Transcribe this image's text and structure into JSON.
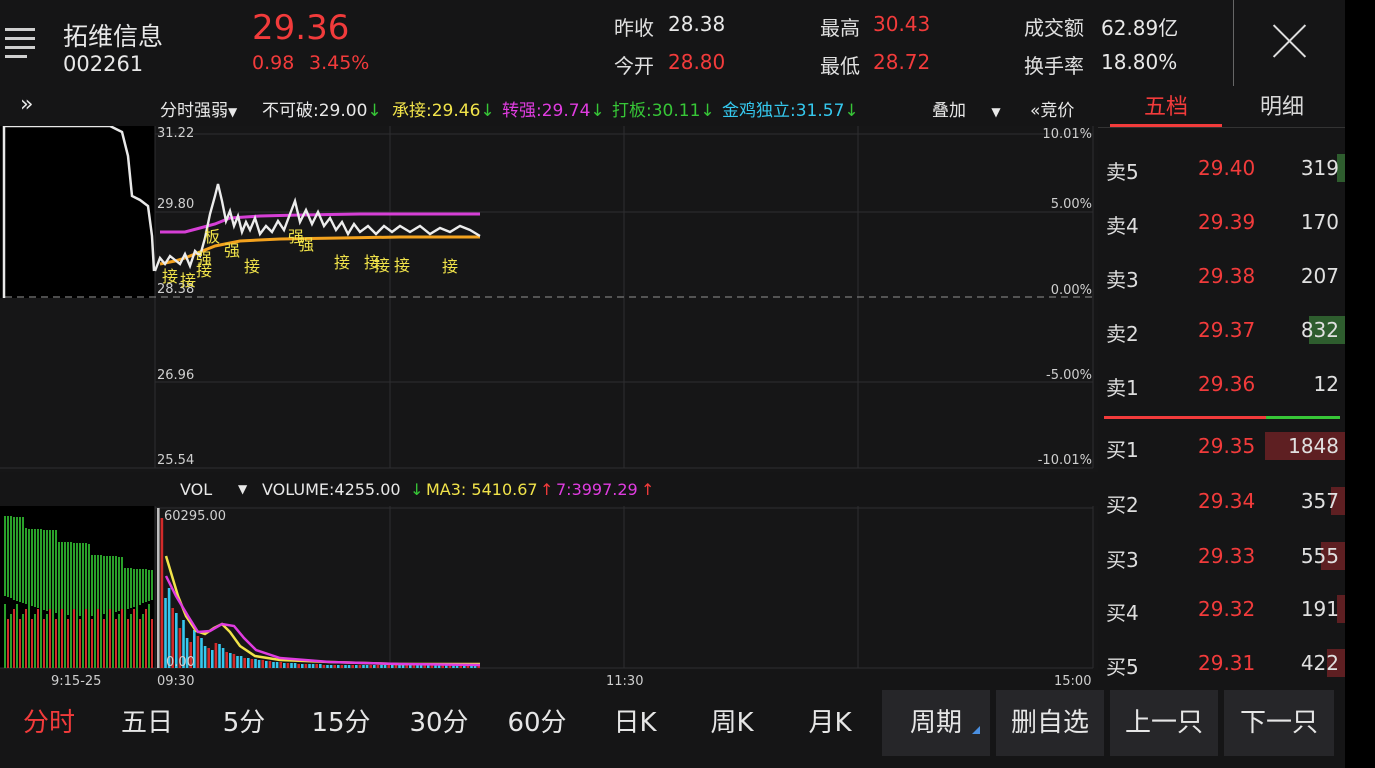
{
  "header": {
    "stock_name": "拓维信息",
    "stock_code": "002261",
    "price": "29.36",
    "change": "0.98",
    "change_pct": "3.45%",
    "prev_close_label": "昨收",
    "prev_close": "28.38",
    "open_label": "今开",
    "open": "28.80",
    "high_label": "最高",
    "high": "30.43",
    "low_label": "最低",
    "low": "28.72",
    "turnover_amt_label": "成交额",
    "turnover_amt": "62.89亿",
    "turnover_rate_label": "换手率",
    "turnover_rate": "18.80%"
  },
  "indicator_bar": {
    "expand_glyph": "»",
    "mode": "分时强弱",
    "items": [
      {
        "label": "不可破:29.00",
        "arrow": "↓"
      },
      {
        "label": "承接:29.46",
        "arrow": "↓"
      },
      {
        "label": "转强:29.74",
        "arrow": "↓"
      },
      {
        "label": "打板:30.11",
        "arrow": "↓"
      },
      {
        "label": "金鸡独立:31.57",
        "arrow": "↓"
      }
    ],
    "overlay": "叠加",
    "auction": "«竞价"
  },
  "price_chart": {
    "y_labels": [
      "31.22",
      "29.80",
      "28.38",
      "26.96",
      "25.54"
    ],
    "pct_labels": [
      "10.01%",
      "5.00%",
      "0.00%",
      "-5.00%",
      "-10.01%"
    ],
    "markers": [
      "接",
      "接",
      "接",
      "强",
      "板",
      "强",
      "接",
      "强",
      "强",
      "接",
      "接",
      "接",
      "接",
      "接"
    ]
  },
  "volume_chart": {
    "indicator": "VOL",
    "volume": "VOLUME:4255.00",
    "volume_arrow": "↓",
    "ma3": "MA3: 5410.67",
    "ma3_arrow": "↑",
    "ma7": "7:3997.29",
    "ma7_arrow": "↑",
    "max_label": "60295.00",
    "min_label": "0.00"
  },
  "time_axis": [
    "9:15-25",
    "09:30",
    "11:30",
    "15:00"
  ],
  "order_book": {
    "tabs": [
      "五档",
      "明细"
    ],
    "active_tab": 0,
    "asks": [
      {
        "level": "卖5",
        "price": "29.40",
        "volume": "319"
      },
      {
        "level": "卖4",
        "price": "29.39",
        "volume": "170"
      },
      {
        "level": "卖3",
        "price": "29.38",
        "volume": "207"
      },
      {
        "level": "卖2",
        "price": "29.37",
        "volume": "832"
      },
      {
        "level": "卖1",
        "price": "29.36",
        "volume": "12"
      }
    ],
    "bids": [
      {
        "level": "买1",
        "price": "29.35",
        "volume": "1848"
      },
      {
        "level": "买2",
        "price": "29.34",
        "volume": "357"
      },
      {
        "level": "买3",
        "price": "29.33",
        "volume": "555"
      },
      {
        "level": "买4",
        "price": "29.32",
        "volume": "191"
      },
      {
        "level": "买5",
        "price": "29.31",
        "volume": "422"
      }
    ]
  },
  "bottom_tabs": [
    "分时",
    "五日",
    "5分",
    "15分",
    "30分",
    "60分",
    "日K",
    "周K",
    "月K",
    "周期"
  ],
  "bottom_active": 0,
  "bottom_buttons": [
    "删自选",
    "上一只",
    "下一只"
  ],
  "colors": {
    "up": "#f23b3b",
    "down": "#37c637",
    "accent": "#f23b3b",
    "cyan": "#35c8ee",
    "yellow": "#f1e34a",
    "magenta": "#e03ce0",
    "orange": "#f3a21e"
  }
}
